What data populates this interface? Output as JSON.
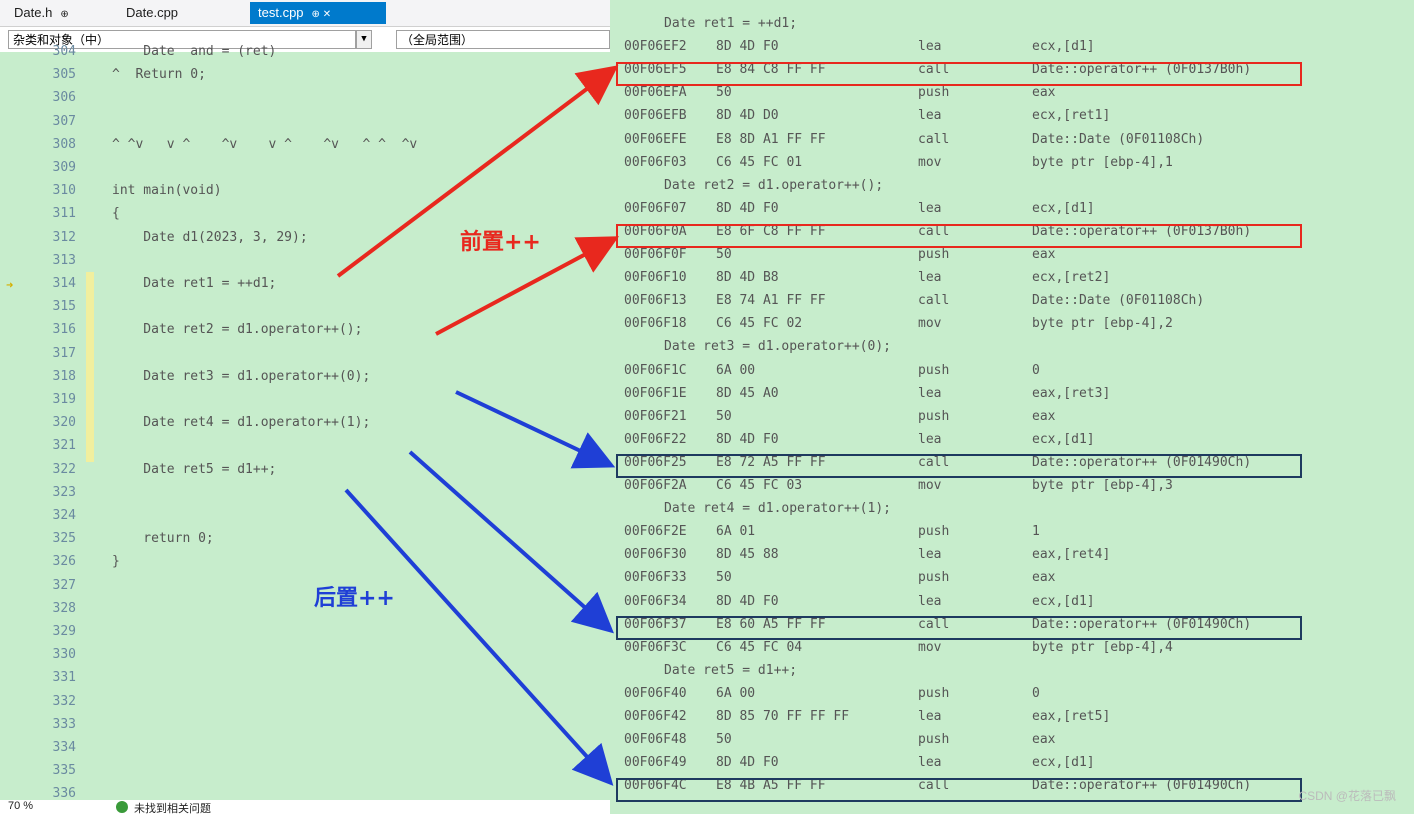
{
  "tabs": [
    {
      "label": "Date.h",
      "pin": "⊕"
    },
    {
      "label": "Date.cpp",
      "pin": ""
    },
    {
      "label": "test.cpp",
      "pin": "⊕ ✕",
      "active": true
    }
  ],
  "scope": {
    "class_combo": "杂类和对象（中）",
    "scope_combo": "（全局范围）"
  },
  "left_code": [
    {
      "ln": "304",
      "text": "    Date  and = (ret)"
    },
    {
      "ln": "305",
      "text": "^  Return 0;"
    },
    {
      "ln": "306",
      "text": ""
    },
    {
      "ln": "307",
      "text": ""
    },
    {
      "ln": "308",
      "text": "^ ^v   v ^    ^v    v ^    ^v   ^ ^  ^v"
    },
    {
      "ln": "309",
      "text": ""
    },
    {
      "ln": "310",
      "text": "int main(void)"
    },
    {
      "ln": "311",
      "text": "{"
    },
    {
      "ln": "312",
      "text": "    Date d1(2023, 3, 29);"
    },
    {
      "ln": "313",
      "text": ""
    },
    {
      "ln": "314",
      "text": "    Date ret1 = ++d1;"
    },
    {
      "ln": "315",
      "text": ""
    },
    {
      "ln": "316",
      "text": "    Date ret2 = d1.operator++();"
    },
    {
      "ln": "317",
      "text": ""
    },
    {
      "ln": "318",
      "text": "    Date ret3 = d1.operator++(0);"
    },
    {
      "ln": "319",
      "text": ""
    },
    {
      "ln": "320",
      "text": "    Date ret4 = d1.operator++(1);"
    },
    {
      "ln": "321",
      "text": ""
    },
    {
      "ln": "322",
      "text": "    Date ret5 = d1++;"
    },
    {
      "ln": "323",
      "text": ""
    },
    {
      "ln": "324",
      "text": ""
    },
    {
      "ln": "325",
      "text": "    return 0;"
    },
    {
      "ln": "326",
      "text": "}"
    },
    {
      "ln": "327",
      "text": ""
    },
    {
      "ln": "328",
      "text": ""
    },
    {
      "ln": "329",
      "text": ""
    },
    {
      "ln": "330",
      "text": ""
    },
    {
      "ln": "331",
      "text": ""
    },
    {
      "ln": "332",
      "text": ""
    },
    {
      "ln": "333",
      "text": ""
    },
    {
      "ln": "334",
      "text": ""
    },
    {
      "ln": "335",
      "text": ""
    },
    {
      "ln": "336",
      "text": ""
    }
  ],
  "disasm": [
    {
      "t": "src",
      "text": "Date ret1 = ++d1;"
    },
    {
      "t": "asm",
      "addr": "00F06EF2",
      "bytes": "8D 4D F0",
      "op": "lea",
      "arg": "ecx,[d1]"
    },
    {
      "t": "asm",
      "addr": "00F06EF5",
      "bytes": "E8 84 C8 FF FF",
      "op": "call",
      "arg": "Date::operator++ (0F0137B0h)"
    },
    {
      "t": "asm",
      "addr": "00F06EFA",
      "bytes": "50",
      "op": "push",
      "arg": "eax"
    },
    {
      "t": "asm",
      "addr": "00F06EFB",
      "bytes": "8D 4D D0",
      "op": "lea",
      "arg": "ecx,[ret1]"
    },
    {
      "t": "asm",
      "addr": "00F06EFE",
      "bytes": "E8 8D A1 FF FF",
      "op": "call",
      "arg": "Date::Date (0F01108Ch)"
    },
    {
      "t": "asm",
      "addr": "00F06F03",
      "bytes": "C6 45 FC 01",
      "op": "mov",
      "arg": "byte ptr [ebp-4],1"
    },
    {
      "t": "src",
      "text": "Date ret2 = d1.operator++();"
    },
    {
      "t": "asm",
      "addr": "00F06F07",
      "bytes": "8D 4D F0",
      "op": "lea",
      "arg": "ecx,[d1]"
    },
    {
      "t": "asm",
      "addr": "00F06F0A",
      "bytes": "E8 6F C8 FF FF",
      "op": "call",
      "arg": "Date::operator++ (0F0137B0h)"
    },
    {
      "t": "asm",
      "addr": "00F06F0F",
      "bytes": "50",
      "op": "push",
      "arg": "eax"
    },
    {
      "t": "asm",
      "addr": "00F06F10",
      "bytes": "8D 4D B8",
      "op": "lea",
      "arg": "ecx,[ret2]"
    },
    {
      "t": "asm",
      "addr": "00F06F13",
      "bytes": "E8 74 A1 FF FF",
      "op": "call",
      "arg": "Date::Date (0F01108Ch)"
    },
    {
      "t": "asm",
      "addr": "00F06F18",
      "bytes": "C6 45 FC 02",
      "op": "mov",
      "arg": "byte ptr [ebp-4],2"
    },
    {
      "t": "src",
      "text": "Date ret3 = d1.operator++(0);"
    },
    {
      "t": "asm",
      "addr": "00F06F1C",
      "bytes": "6A 00",
      "op": "push",
      "arg": "0"
    },
    {
      "t": "asm",
      "addr": "00F06F1E",
      "bytes": "8D 45 A0",
      "op": "lea",
      "arg": "eax,[ret3]"
    },
    {
      "t": "asm",
      "addr": "00F06F21",
      "bytes": "50",
      "op": "push",
      "arg": "eax"
    },
    {
      "t": "asm",
      "addr": "00F06F22",
      "bytes": "8D 4D F0",
      "op": "lea",
      "arg": "ecx,[d1]"
    },
    {
      "t": "asm",
      "addr": "00F06F25",
      "bytes": "E8 72 A5 FF FF",
      "op": "call",
      "arg": "Date::operator++ (0F01490Ch)"
    },
    {
      "t": "asm",
      "addr": "00F06F2A",
      "bytes": "C6 45 FC 03",
      "op": "mov",
      "arg": "byte ptr [ebp-4],3"
    },
    {
      "t": "src",
      "text": "Date ret4 = d1.operator++(1);"
    },
    {
      "t": "asm",
      "addr": "00F06F2E",
      "bytes": "6A 01",
      "op": "push",
      "arg": "1"
    },
    {
      "t": "asm",
      "addr": "00F06F30",
      "bytes": "8D 45 88",
      "op": "lea",
      "arg": "eax,[ret4]"
    },
    {
      "t": "asm",
      "addr": "00F06F33",
      "bytes": "50",
      "op": "push",
      "arg": "eax"
    },
    {
      "t": "asm",
      "addr": "00F06F34",
      "bytes": "8D 4D F0",
      "op": "lea",
      "arg": "ecx,[d1]"
    },
    {
      "t": "asm",
      "addr": "00F06F37",
      "bytes": "E8 60 A5 FF FF",
      "op": "call",
      "arg": "Date::operator++ (0F01490Ch)"
    },
    {
      "t": "asm",
      "addr": "00F06F3C",
      "bytes": "C6 45 FC 04",
      "op": "mov",
      "arg": "byte ptr [ebp-4],4"
    },
    {
      "t": "src",
      "text": "Date ret5 = d1++;"
    },
    {
      "t": "asm",
      "addr": "00F06F40",
      "bytes": "6A 00",
      "op": "push",
      "arg": "0"
    },
    {
      "t": "asm",
      "addr": "00F06F42",
      "bytes": "8D 85 70 FF FF FF",
      "op": "lea",
      "arg": "eax,[ret5]"
    },
    {
      "t": "asm",
      "addr": "00F06F48",
      "bytes": "50",
      "op": "push",
      "arg": "eax"
    },
    {
      "t": "asm",
      "addr": "00F06F49",
      "bytes": "8D 4D F0",
      "op": "lea",
      "arg": "ecx,[d1]"
    },
    {
      "t": "asm",
      "addr": "00F06F4C",
      "bytes": "E8 4B A5 FF FF",
      "op": "call",
      "arg": "Date::operator++ (0F01490Ch)"
    }
  ],
  "annotations": {
    "prefix": "前置++",
    "postfix": "后置++"
  },
  "status": {
    "zoom": "70 %",
    "issues": "未找到相关问题"
  },
  "watermark": "CSDN @花落已飘",
  "colors": {
    "red": "#e8281e",
    "blue": "#1f3fd6",
    "dark_box": "#1e3a5f",
    "bg": "#c7edcc",
    "keyword": "#2a3cc7"
  }
}
